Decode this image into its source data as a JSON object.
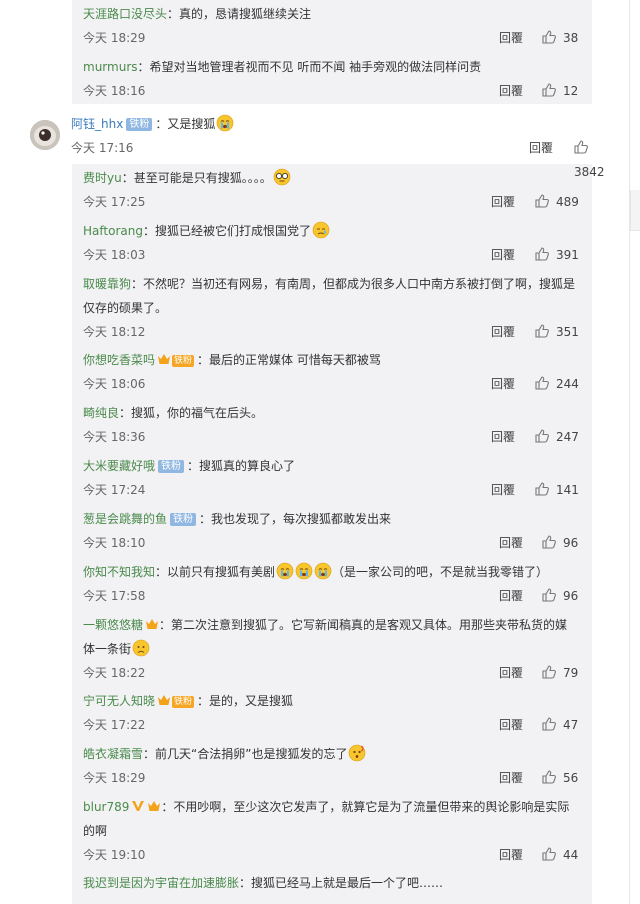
{
  "ui": {
    "reply_label": "回覆"
  },
  "top_comments": [
    {
      "user": "天涯路口没尽头",
      "text": "：真的，恳请搜狐继续关注",
      "time": "今天 18:29",
      "likes": "38"
    },
    {
      "user": "murmurs",
      "text": "：希望对当地管理者视而不见 听而不闻 袖手旁观的做法同样问责",
      "time": "今天 18:16",
      "likes": "12"
    }
  ],
  "main_comment": {
    "user": "阿钰_hhx",
    "badge": "铁粉",
    "text": "：又是搜狐",
    "time": "今天 17:16",
    "likes": "3842"
  },
  "replies": [
    {
      "user": "费时yu",
      "text": "：甚至可能是只有搜狐。。。。",
      "time": "今天 17:25",
      "likes": "489"
    },
    {
      "user": "Haftorang",
      "text": "：搜狐已经被它们打成恨国党了",
      "time": "今天 18:03",
      "likes": "391"
    },
    {
      "user": "取暖靠狗",
      "text": "：不然呢？当初还有网易，有南周，但都成为很多人口中南方系被打倒了啊，搜狐是",
      "text2": "仅存的硕果了。",
      "time": "今天 18:12",
      "likes": "351"
    },
    {
      "user": "你想吃香菜吗",
      "badge": "铁粉",
      "text": "：最后的正常媒体 可惜每天都被骂",
      "time": "今天 18:06",
      "likes": "244"
    },
    {
      "user": "畸纯良",
      "text": "：搜狐，你的福气在后头。",
      "time": "今天 18:36",
      "likes": "247"
    },
    {
      "user": "大米要藏好哦",
      "badge": "铁粉",
      "text": "：搜狐真的算良心了",
      "time": "今天 17:24",
      "likes": "141"
    },
    {
      "user": "葱是会跳舞的鱼",
      "badge": "铁粉",
      "text": "：我也发现了，每次搜狐都敢发出来",
      "time": "今天 18:10",
      "likes": "96"
    },
    {
      "user": "你知不知我知",
      "text": "：以前只有搜狐有美剧",
      "text_tail": "（是一家公司的吧，不是就当我零错了）",
      "time": "今天 17:58",
      "likes": "96"
    },
    {
      "user": "一颗悠悠糖",
      "text": "：第二次注意到搜狐了。它写新闻稿真的是客观又具体。用那些夹带私货的媒",
      "text2": "体一条街",
      "time": "今天 18:22",
      "likes": "79"
    },
    {
      "user": "宁可无人知晓",
      "badge": "铁粉",
      "text": "：是的，又是搜狐",
      "time": "今天 17:22",
      "likes": "47"
    },
    {
      "user": "皓衣凝霜雪",
      "text": "：前几天“合法捐卵”也是搜狐发的忘了",
      "time": "今天 18:29",
      "likes": "56"
    },
    {
      "user": "blur789",
      "text": "：不用吵啊，至少这次它发声了，就算它是为了流量但带来的舆论影响是实际",
      "text2": "的啊",
      "time": "今天 19:10",
      "likes": "44"
    },
    {
      "user": "我迟到是因为宇宙在加速膨胀",
      "text": "：搜狐已经马上就是最后一个了吧……"
    }
  ]
}
